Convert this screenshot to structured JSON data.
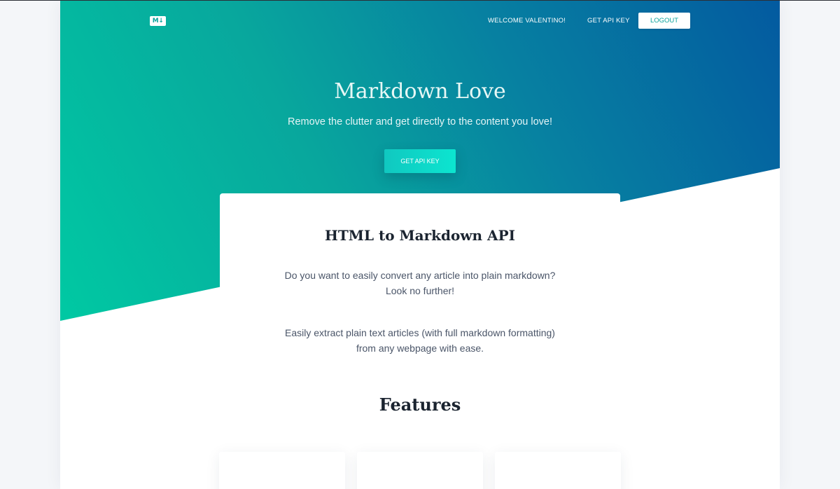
{
  "nav": {
    "logo": "M↓",
    "welcome": "WELCOME VALENTINO!",
    "get_api_key": "GET API KEY",
    "logout": "LOGOUT"
  },
  "hero": {
    "title": "Markdown Love",
    "subtitle": "Remove the clutter and get directly to the content you love!",
    "cta": "GET API KEY"
  },
  "intro": {
    "title": "HTML to Markdown API",
    "para1_line1": "Do you want to easily convert any article into plain markdown?",
    "para1_line2": "Look no further!",
    "para2_line1": "Easily extract plain text articles (with full markdown formatting)",
    "para2_line2": "from any webpage with ease."
  },
  "features": {
    "title": "Features"
  },
  "colors": {
    "gradient_start": "#00c9a3",
    "gradient_end": "#035aa0",
    "accent": "#0aa39c",
    "heading": "#1b2430",
    "body_text": "#4a5568"
  }
}
